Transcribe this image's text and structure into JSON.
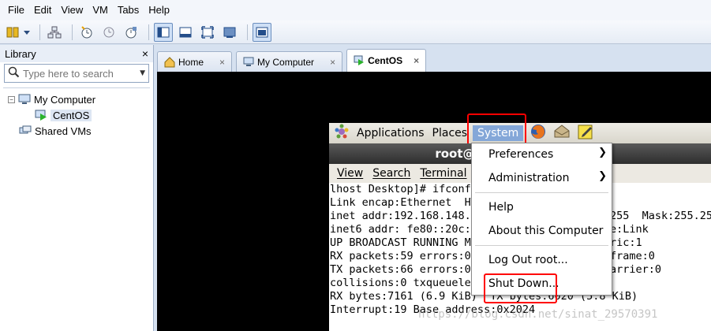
{
  "menubar": {
    "items": [
      "File",
      "Edit",
      "View",
      "VM",
      "Tabs",
      "Help"
    ]
  },
  "toolbar": {
    "icons": [
      "power-icon",
      "dropdown-arrow-icon",
      "network-icon",
      "snapshot-icon",
      "revert-snapshot-icon",
      "manage-snapshots-icon",
      "show-library-icon",
      "thumbnail-bar-icon",
      "full-screen-icon",
      "unity-icon",
      "console-view-icon"
    ]
  },
  "library": {
    "title": "Library",
    "close": "×",
    "search_placeholder": "Type here to search",
    "tree": {
      "root_expander": "−",
      "my_computer": "My Computer",
      "centos": "CentOS",
      "shared_vms": "Shared VMs"
    }
  },
  "tabs": [
    {
      "label": "Home",
      "close": "×"
    },
    {
      "label": "My Computer",
      "close": "×"
    },
    {
      "label": "CentOS",
      "close": "×"
    }
  ],
  "guest": {
    "panel": {
      "applications": "Applications",
      "places": "Places",
      "system": "System"
    },
    "terminal_title": "root@l",
    "terminal_menu": [
      "View",
      "Search",
      "Terminal"
    ],
    "terminal_lines": [
      {
        "left": "lhost Desktop]# ifconf",
        "right": ""
      },
      {
        "left": "Link encap:Ethernet  HW",
        "right": ""
      },
      {
        "left": "inet addr:192.168.148.",
        "right": "255  Mask:255.25"
      },
      {
        "left": "inet6 addr: fe80::20c:",
        "right": "e:Link"
      },
      {
        "left": "UP BROADCAST RUNNING MU",
        "right": "ric:1"
      },
      {
        "left": "RX packets:59 errors:0",
        "right": "frame:0"
      },
      {
        "left": "TX packets:66 errors:0",
        "right": "arrier:0"
      },
      {
        "left": "collisions:0 txqueuelen",
        "right": ""
      },
      {
        "left": "RX bytes:7161 (6.9 KiB)  TX bytes:6020 (5.8 KiB)",
        "right": ""
      },
      {
        "left": "Interrupt:19 Base address:0x2024",
        "right": ""
      }
    ],
    "system_menu": {
      "preferences": "Preferences",
      "administration": "Administration",
      "help": "Help",
      "about": "About this Computer",
      "logout": "Log Out root...",
      "shutdown": "Shut Down...",
      "arrow": "❯"
    }
  },
  "watermark": "https://blog.csdn.net/sinat_29570391",
  "colors": {
    "highlight": "#ff0000",
    "system_selected": "#84a7d8",
    "vm_background": "#000000"
  }
}
